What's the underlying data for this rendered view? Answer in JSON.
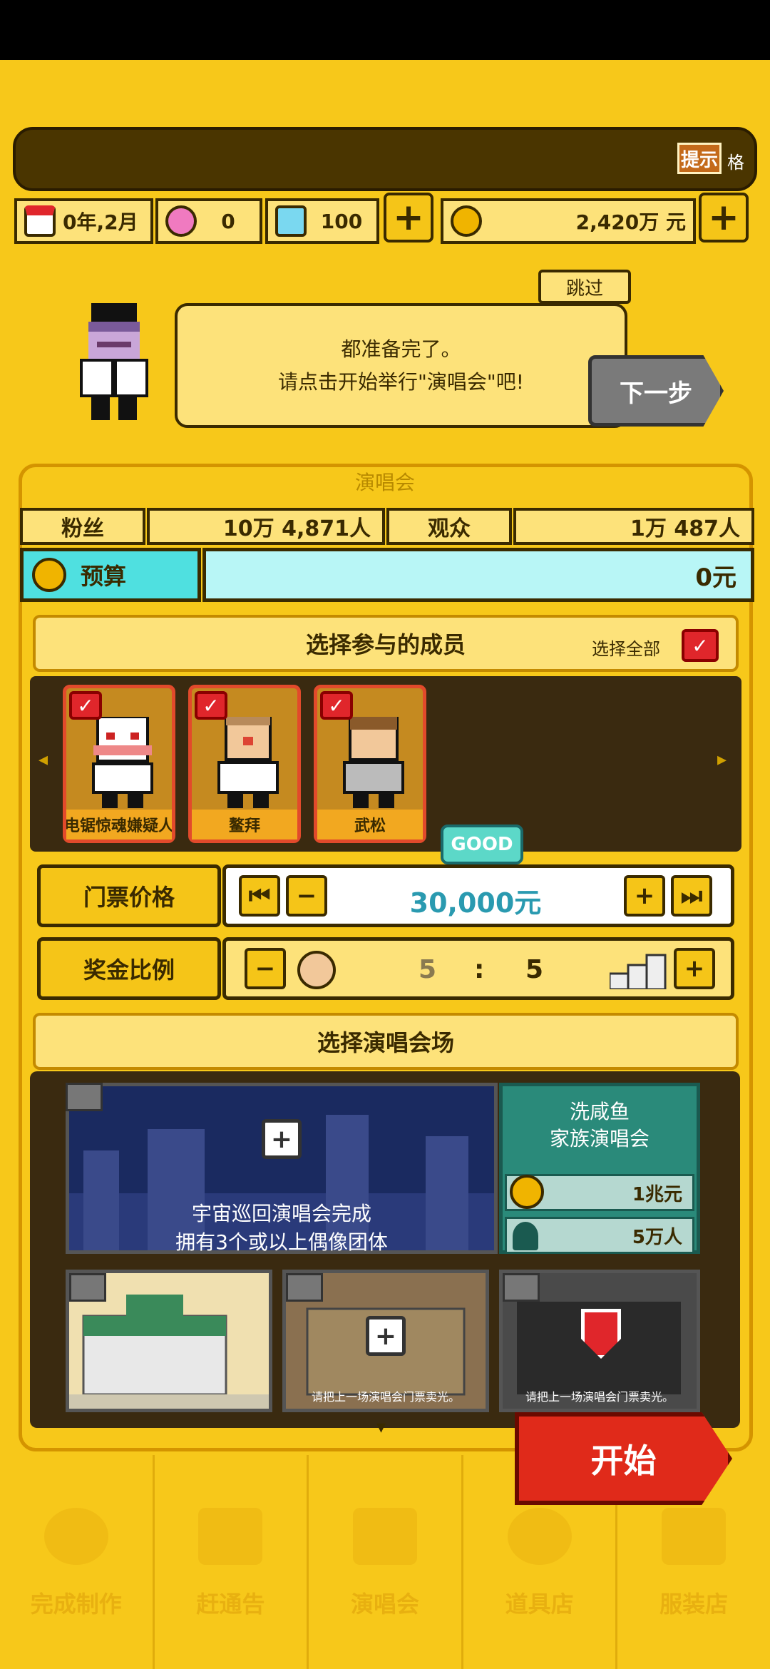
{
  "header": {
    "hint_label": "提示",
    "hint_suffix": "格",
    "date": "0年,2月",
    "gems": "0",
    "diamonds": "100",
    "money": "2,420万 元",
    "plus_symbol": "+"
  },
  "dialog": {
    "skip_label": "跳过",
    "line1": "都准备完了。",
    "line2": "请点击开始举行\"演唱会\"吧!",
    "next_label": "下一步"
  },
  "panel": {
    "tab_title": "演唱会",
    "fans_label": "粉丝",
    "fans_value": "10万 4,871人",
    "audience_label": "观众",
    "audience_value": "1万 487人",
    "budget_label": "预算",
    "budget_value": "0元"
  },
  "members": {
    "title": "选择参与的成员",
    "select_all": "选择全部",
    "check_symbol": "✓",
    "left_arrow": "◂",
    "right_arrow": "▸",
    "list": [
      {
        "name": "电锯惊魂嫌疑人"
      },
      {
        "name": "鳌拜"
      },
      {
        "name": "武松"
      }
    ]
  },
  "ticket": {
    "label": "门票价格",
    "rating": "GOOD",
    "value": "30,000元",
    "btn_ff_left": "⏮",
    "btn_minus": "−",
    "btn_plus": "+",
    "btn_ff_right": "⏭"
  },
  "bonus": {
    "label": "奖金比例",
    "left": "5",
    "sep": ":",
    "right": "5",
    "btn_minus": "−",
    "btn_plus": "+"
  },
  "venue": {
    "title": "选择演唱会场",
    "main_caption_1": "宇宙巡回演唱会完成",
    "main_caption_2": "拥有3个或以上偶像团体",
    "info_title_1": "洗咸鱼",
    "info_title_2": "家族演唱会",
    "cost": "1兆元",
    "capacity": "5万人",
    "thumb2_caption": "请把上一场演唱会门票卖光。",
    "thumb3_caption": "请把上一场演唱会门票卖光。",
    "down_arrow": "▾",
    "lock_symbol": "+"
  },
  "start_label": "开始",
  "nav": [
    {
      "label": "完成制作"
    },
    {
      "label": "赶通告"
    },
    {
      "label": "演唱会"
    },
    {
      "label": "道具店"
    },
    {
      "label": "服装店"
    }
  ],
  "colors": {
    "background": "#f7c81a",
    "dark_brown": "#3a2a00",
    "budget_cyan": "#4fe0e0",
    "ticket_teal": "#2a9ab0",
    "start_red": "#e02a1a",
    "member_border": "#e24a2b"
  }
}
